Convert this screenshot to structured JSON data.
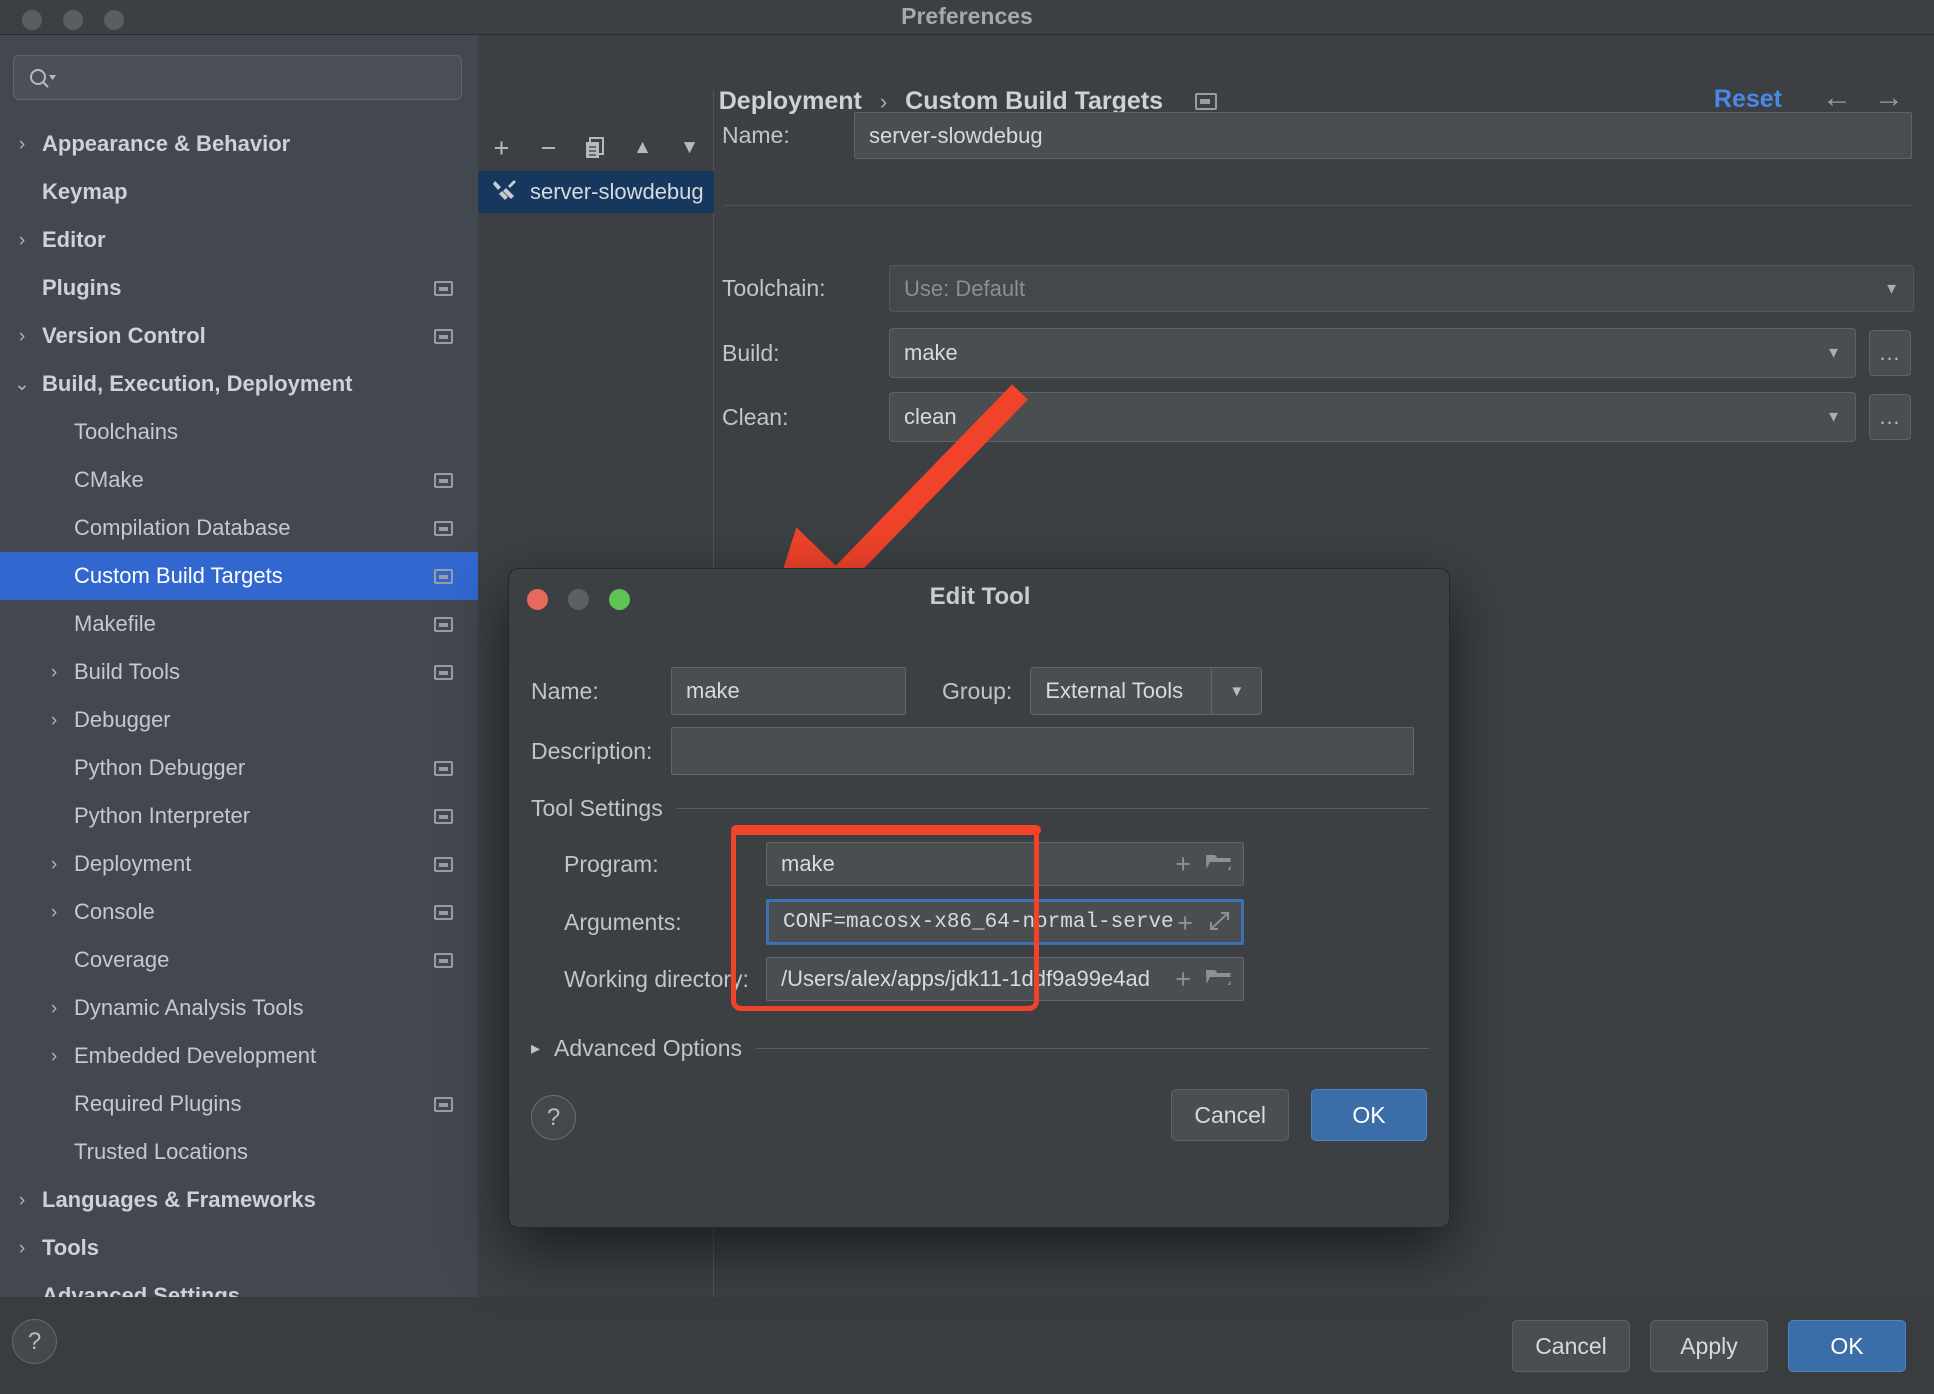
{
  "window": {
    "title": "Preferences"
  },
  "search": {
    "placeholder": "",
    "value": "",
    "icon": "search-icon"
  },
  "sidebar": {
    "items": [
      {
        "label": "Appearance & Behavior",
        "level": 0,
        "arrow": "›",
        "bold": true,
        "badge": false,
        "selected": false
      },
      {
        "label": "Keymap",
        "level": 0,
        "arrow": "",
        "bold": true,
        "badge": false,
        "selected": false
      },
      {
        "label": "Editor",
        "level": 0,
        "arrow": "›",
        "bold": true,
        "badge": false,
        "selected": false
      },
      {
        "label": "Plugins",
        "level": 0,
        "arrow": "",
        "bold": true,
        "badge": true,
        "selected": false
      },
      {
        "label": "Version Control",
        "level": 0,
        "arrow": "›",
        "bold": true,
        "badge": true,
        "selected": false
      },
      {
        "label": "Build, Execution, Deployment",
        "level": 0,
        "arrow": "⌄",
        "bold": true,
        "badge": false,
        "selected": false
      },
      {
        "label": "Toolchains",
        "level": 1,
        "arrow": "",
        "bold": false,
        "badge": false,
        "selected": false
      },
      {
        "label": "CMake",
        "level": 1,
        "arrow": "",
        "bold": false,
        "badge": true,
        "selected": false
      },
      {
        "label": "Compilation Database",
        "level": 1,
        "arrow": "",
        "bold": false,
        "badge": true,
        "selected": false
      },
      {
        "label": "Custom Build Targets",
        "level": 1,
        "arrow": "",
        "bold": false,
        "badge": true,
        "selected": true
      },
      {
        "label": "Makefile",
        "level": 1,
        "arrow": "",
        "bold": false,
        "badge": true,
        "selected": false
      },
      {
        "label": "Build Tools",
        "level": 1,
        "arrow": "›",
        "bold": false,
        "badge": true,
        "selected": false
      },
      {
        "label": "Debugger",
        "level": 1,
        "arrow": "›",
        "bold": false,
        "badge": false,
        "selected": false
      },
      {
        "label": "Python Debugger",
        "level": 1,
        "arrow": "",
        "bold": false,
        "badge": true,
        "selected": false
      },
      {
        "label": "Python Interpreter",
        "level": 1,
        "arrow": "",
        "bold": false,
        "badge": true,
        "selected": false
      },
      {
        "label": "Deployment",
        "level": 1,
        "arrow": "›",
        "bold": false,
        "badge": true,
        "selected": false
      },
      {
        "label": "Console",
        "level": 1,
        "arrow": "›",
        "bold": false,
        "badge": true,
        "selected": false
      },
      {
        "label": "Coverage",
        "level": 1,
        "arrow": "",
        "bold": false,
        "badge": true,
        "selected": false
      },
      {
        "label": "Dynamic Analysis Tools",
        "level": 1,
        "arrow": "›",
        "bold": false,
        "badge": false,
        "selected": false
      },
      {
        "label": "Embedded Development",
        "level": 1,
        "arrow": "›",
        "bold": false,
        "badge": false,
        "selected": false
      },
      {
        "label": "Required Plugins",
        "level": 1,
        "arrow": "",
        "bold": false,
        "badge": true,
        "selected": false
      },
      {
        "label": "Trusted Locations",
        "level": 1,
        "arrow": "",
        "bold": false,
        "badge": false,
        "selected": false
      },
      {
        "label": "Languages & Frameworks",
        "level": 0,
        "arrow": "›",
        "bold": true,
        "badge": false,
        "selected": false
      },
      {
        "label": "Tools",
        "level": 0,
        "arrow": "›",
        "bold": true,
        "badge": false,
        "selected": false
      },
      {
        "label": "Advanced Settings",
        "level": 0,
        "arrow": "",
        "bold": true,
        "badge": false,
        "selected": false
      }
    ],
    "help_label": "?"
  },
  "header": {
    "breadcrumb_root": "Build, Execution, Deployment",
    "breadcrumb_sep": "›",
    "breadcrumb_leaf": "Custom Build Targets",
    "reset_label": "Reset",
    "back_icon": "←",
    "forward_icon": "→"
  },
  "targets": {
    "toolbar": {
      "add": "+",
      "remove": "−",
      "copy": "copy-icon",
      "move_up": "▲",
      "move_down": "▼"
    },
    "items": [
      {
        "name": "server-slowdebug",
        "icon": "tools-icon",
        "selected": true
      }
    ]
  },
  "form": {
    "name_label": "Name:",
    "name_value": "server-slowdebug",
    "toolchain_label": "Toolchain:",
    "toolchain_value": "Use: Default",
    "build_label": "Build:",
    "build_value": "make",
    "clean_label": "Clean:",
    "clean_value": "clean",
    "ellipsis_label": "…"
  },
  "footer": {
    "cancel_label": "Cancel",
    "apply_label": "Apply",
    "ok_label": "OK"
  },
  "dialog": {
    "title": "Edit Tool",
    "name_label": "Name:",
    "name_value": "make",
    "group_label": "Group:",
    "group_value": "External Tools",
    "description_label": "Description:",
    "description_value": "",
    "tool_settings_label": "Tool Settings",
    "program_label": "Program:",
    "program_value": "make",
    "arguments_label": "Arguments:",
    "arguments_value": "CONF=macosx-x86_64-normal-serve",
    "working_dir_label": "Working directory:",
    "working_dir_value": "/Users/alex/apps/jdk11-1ddf9a99e4ad",
    "advanced_options_label": "Advanced Options",
    "advanced_arrow": "▸",
    "help_label": "?",
    "cancel_label": "Cancel",
    "ok_label": "OK",
    "insert_macro_icon": "+",
    "browse_icon": "folder-icon",
    "expand_icon": "expand-icon"
  },
  "annotations": {
    "arrow_color": "#f0432a",
    "highlight_color": "#f0432a"
  },
  "colors": {
    "accent_blue": "#3267d0",
    "reset_blue": "#4a88e8",
    "primary_button": "#3b6ea8",
    "selection_dark_blue": "#17385e"
  }
}
